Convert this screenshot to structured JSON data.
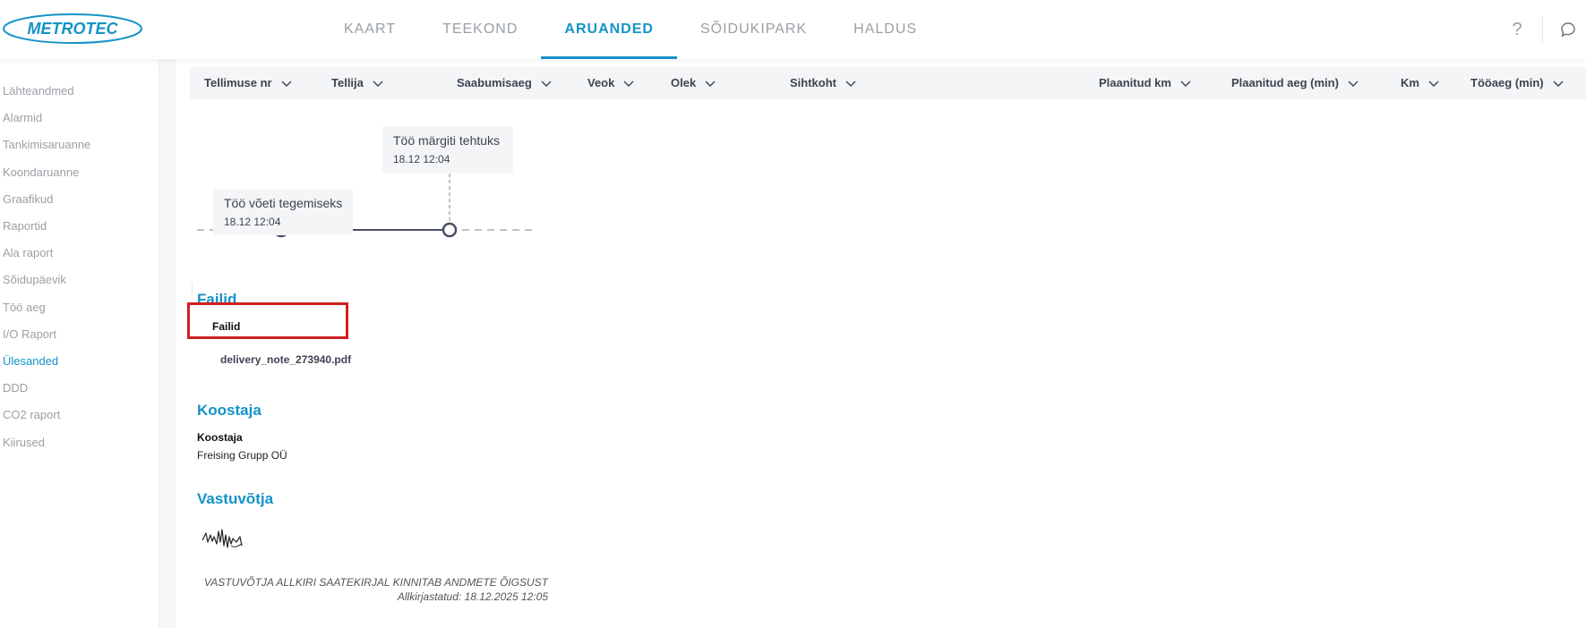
{
  "brand": {
    "name": "METROTEC",
    "color": "#1593c7"
  },
  "nav": {
    "items": [
      {
        "label": "KAART",
        "active": false
      },
      {
        "label": "TEEKOND",
        "active": false
      },
      {
        "label": "ARUANDED",
        "active": true
      },
      {
        "label": "SÕIDUKIPARK",
        "active": false
      },
      {
        "label": "HALDUS",
        "active": false
      }
    ],
    "help_label": "?"
  },
  "sidebar": {
    "items": [
      {
        "label": "Lähteandmed",
        "active": false
      },
      {
        "label": "Alarmid",
        "active": false
      },
      {
        "label": "Tankimisaruanne",
        "active": false
      },
      {
        "label": "Koondaruanne",
        "active": false
      },
      {
        "label": "Graafikud",
        "active": false
      },
      {
        "label": "Raportid",
        "active": false
      },
      {
        "label": "Ala raport",
        "active": false
      },
      {
        "label": "Sõidupäevik",
        "active": false
      },
      {
        "label": "Töö aeg",
        "active": false
      },
      {
        "label": "I/O Raport",
        "active": false
      },
      {
        "label": "Ülesanded",
        "active": true
      },
      {
        "label": "DDD",
        "active": false
      },
      {
        "label": "CO2 raport",
        "active": false
      },
      {
        "label": "Kiirused",
        "active": false
      }
    ]
  },
  "table": {
    "columns": [
      "Tellimuse nr",
      "Tellija",
      "Saabumisaeg",
      "Veok",
      "Olek",
      "Sihtkoht",
      "Plaanitud km",
      "Plaanitud aeg (min)",
      "Km",
      "Tööaeg (min)"
    ]
  },
  "timeline": {
    "events": [
      {
        "title": "Töö võeti tegemiseks",
        "time": "18.12 12:04"
      },
      {
        "title": "Töö märgiti tehtuks",
        "time": "18.12 12:04"
      }
    ]
  },
  "files": {
    "section_title": "Failid",
    "label": "Failid",
    "items": [
      "delivery_note_273940.pdf"
    ]
  },
  "creator": {
    "section_title": "Koostaja",
    "label": "Koostaja",
    "value": "Freising Grupp OÜ"
  },
  "receiver": {
    "section_title": "Vastuvõtja",
    "note": "VASTUVÕTJA ALLKIRI SAATEKIRJAL KINNITAB ANDMETE ÕIGSUST",
    "signed_at": "Allkirjastatud: 18.12.2025 12:05"
  }
}
